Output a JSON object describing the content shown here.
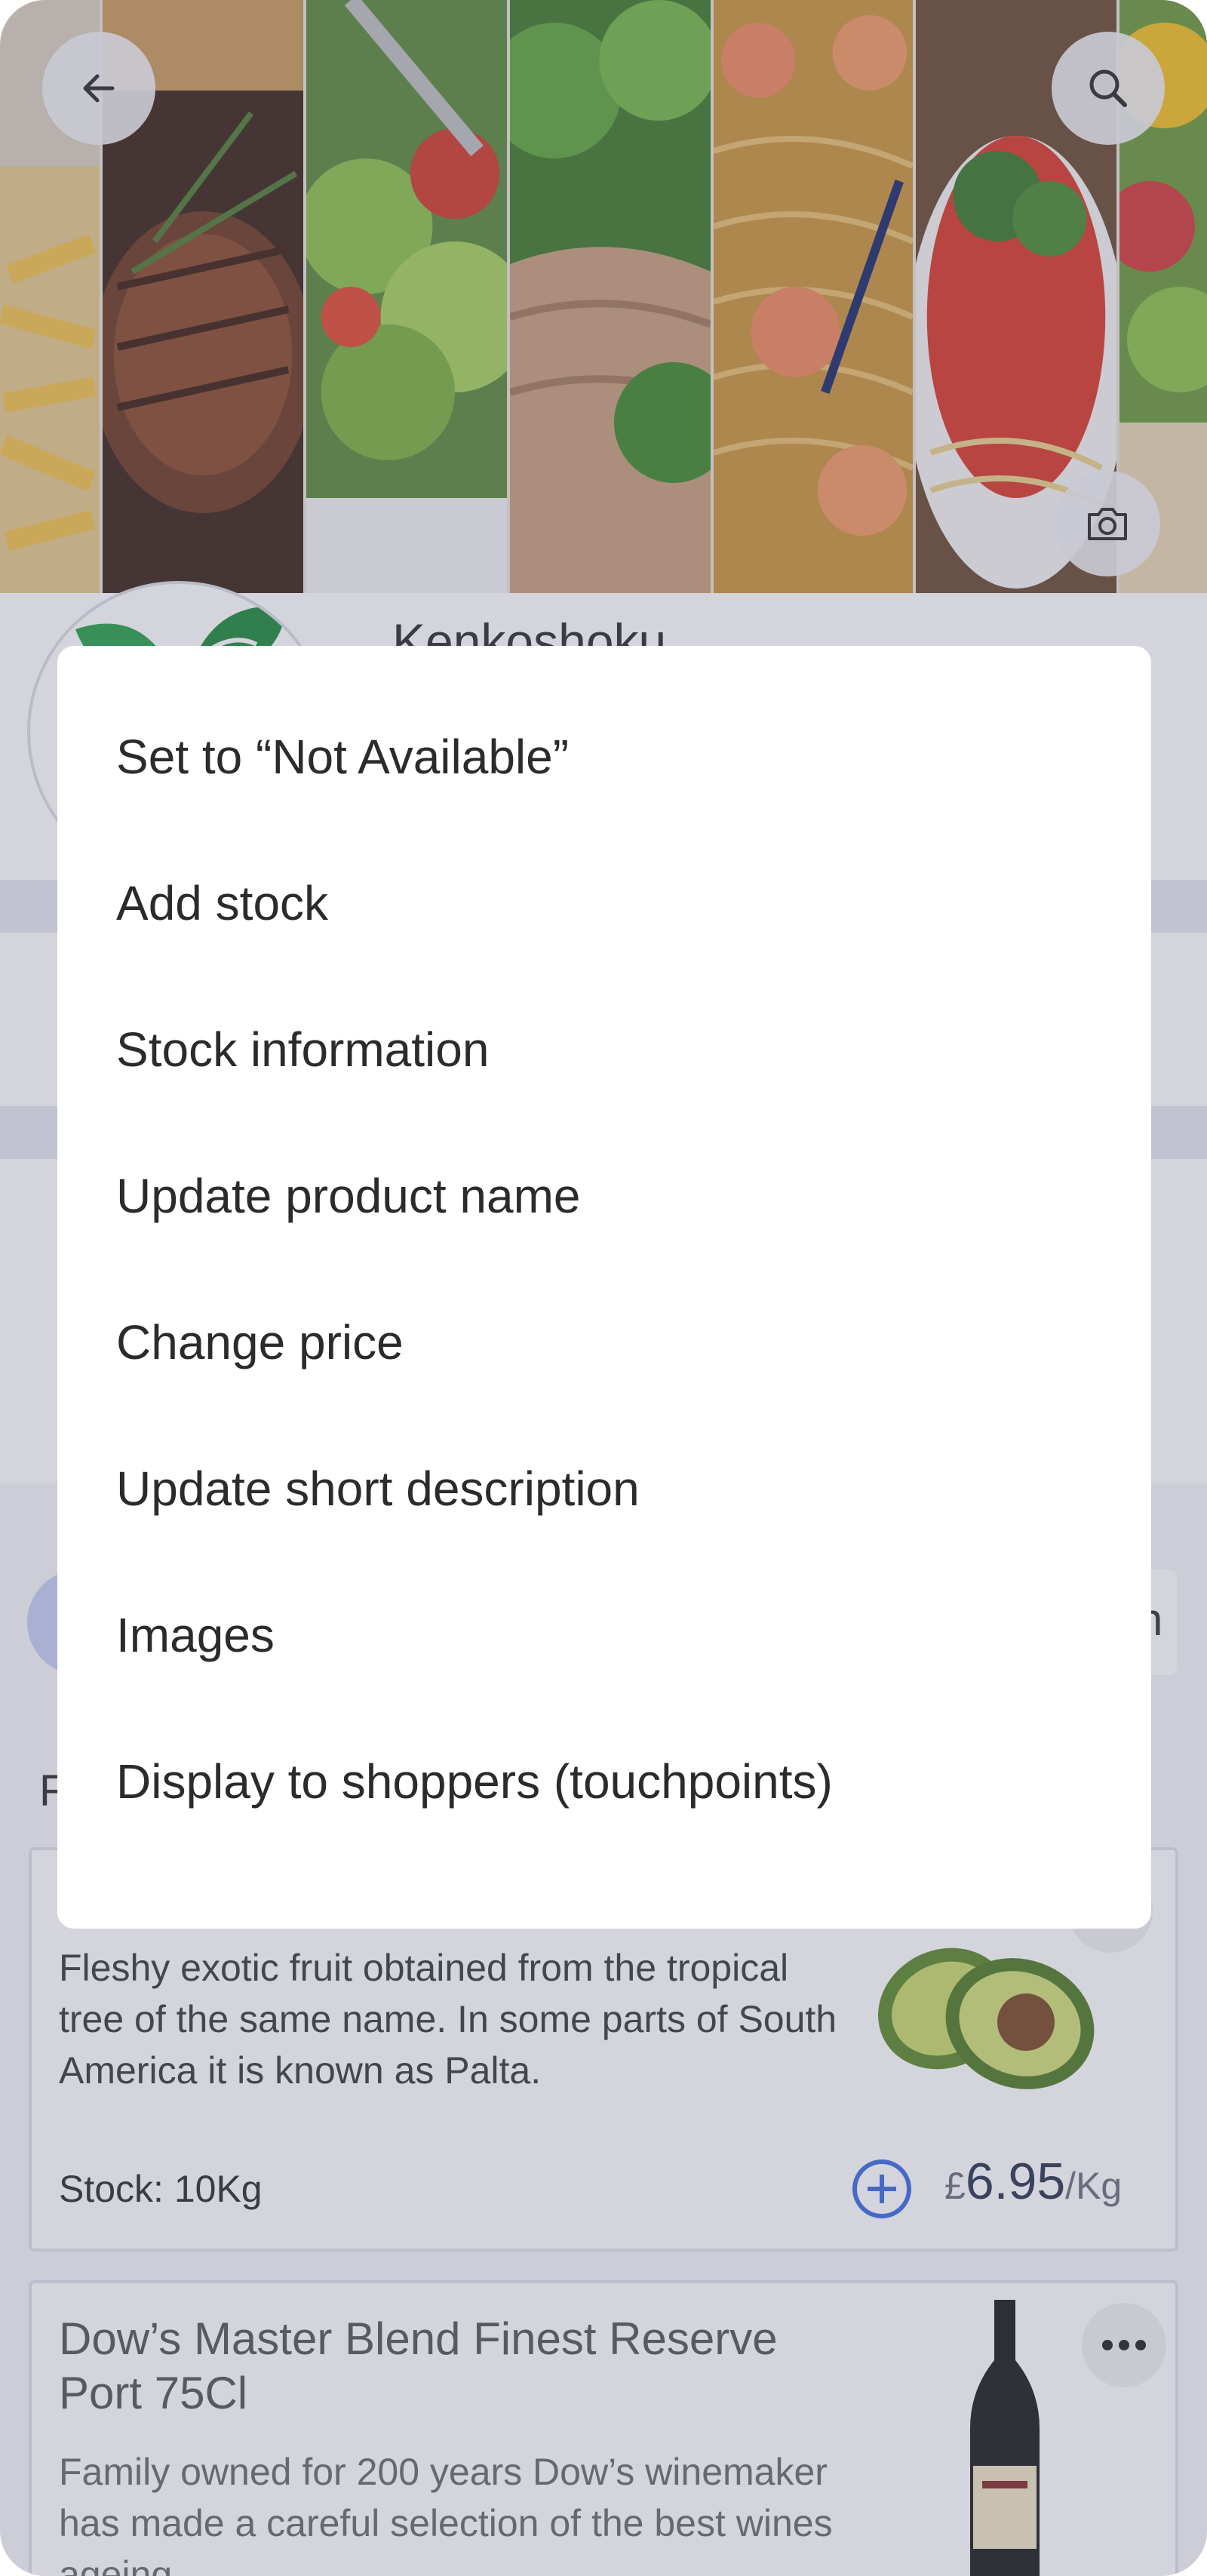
{
  "header": {
    "back_icon": "arrow-left-icon",
    "search_icon": "search-icon",
    "camera_icon": "camera-icon"
  },
  "store": {
    "name": "Kenkoshoku"
  },
  "tabs": {
    "right_partial": "n"
  },
  "section": {
    "heading_partial": "F"
  },
  "products": [
    {
      "description": "Fleshy exotic fruit obtained from the tropical tree of the same name. In some parts of South America it is known as Palta.",
      "stock": "Stock: 10Kg",
      "currency": "£",
      "price": "6.95",
      "unit": "/Kg"
    },
    {
      "title": "Dow’s Master Blend Finest Reserve Port 75Cl",
      "description": "Family owned for 200 years Dow’s winemaker has made a careful selection of the best wines ageing"
    }
  ],
  "action_sheet": {
    "items": [
      "Set to “Not Available”",
      "Add stock",
      "Stock information",
      "Update product name",
      "Change price",
      "Update short description",
      "Images",
      "Display to shoppers (touchpoints)"
    ]
  },
  "colors": {
    "accent": "#3a6de0",
    "scrim": "#64648247"
  }
}
